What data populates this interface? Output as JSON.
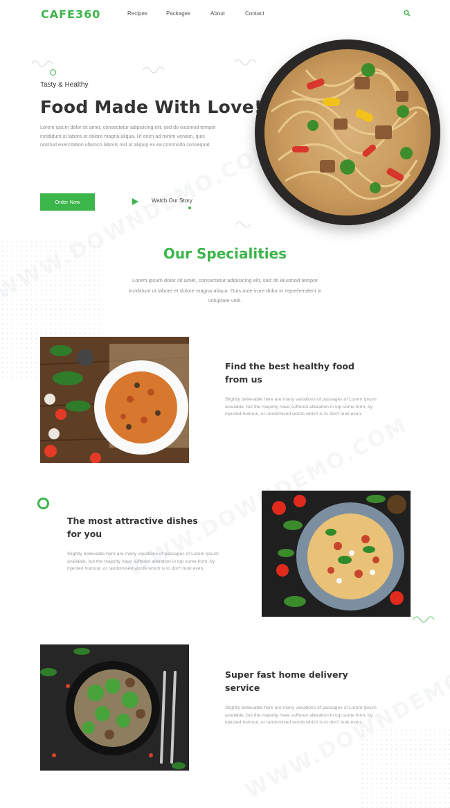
{
  "header": {
    "logo": "CAFE360",
    "nav": [
      "Recipes",
      "Packages",
      "About",
      "Contact"
    ],
    "search_icon": "search-icon"
  },
  "hero": {
    "tagline": "Tasty & Healthy",
    "title": "Food Made With Love!",
    "text": "Lorem ipsum dolor sit amet, consectetur adipisicing elit, sed do eiusmod tempor incididunt ut labore et dolore magna aliqua. Ut enim ad minim veniam, quis nostrud exercitation ullamco laboris nisi ut aliquip ex ea commodo consequat.",
    "order_label": "Order Now",
    "watch_label": "Watch Our Story"
  },
  "specialities": {
    "title": "Our Specialities",
    "text": "Lorem ipsum dolor sit amet, consectetur adipisicing elit, sed do eiusmod tempor incididunt ut labore et dolore magna aliqua. Duis aute irure dolor in reprehenderit in voluptate velit."
  },
  "features": [
    {
      "title_line1": "Find the best healthy food",
      "title_line2": "from us",
      "text": "Slightly believable here are many variations of passages of Lorem Ipsum available, but the majority have suffered alteration in top some form, by injected humour, or randomised words which is to don't look even."
    },
    {
      "title_line1": "The most attractive dishes",
      "title_line2": "for you",
      "text": "Slightly believable here are many variations of passages of Lorem Ipsum available, but the majority have suffered alteration in top some form, by injected humour, or randomised words which is to don't look even."
    },
    {
      "title_line1": "Super fast home delivery",
      "title_line2": "service",
      "text": "Slightly believable here are many variations of passages of Lorem Ipsum available, but the majority have suffered alteration in top some form, by injected humour, or randomised words which is to don't look even."
    }
  ],
  "watermark": "WWW.DOWNDEMO.COM",
  "colors": {
    "accent": "#3cb54a",
    "text": "#333333",
    "muted": "#8a8f96"
  }
}
